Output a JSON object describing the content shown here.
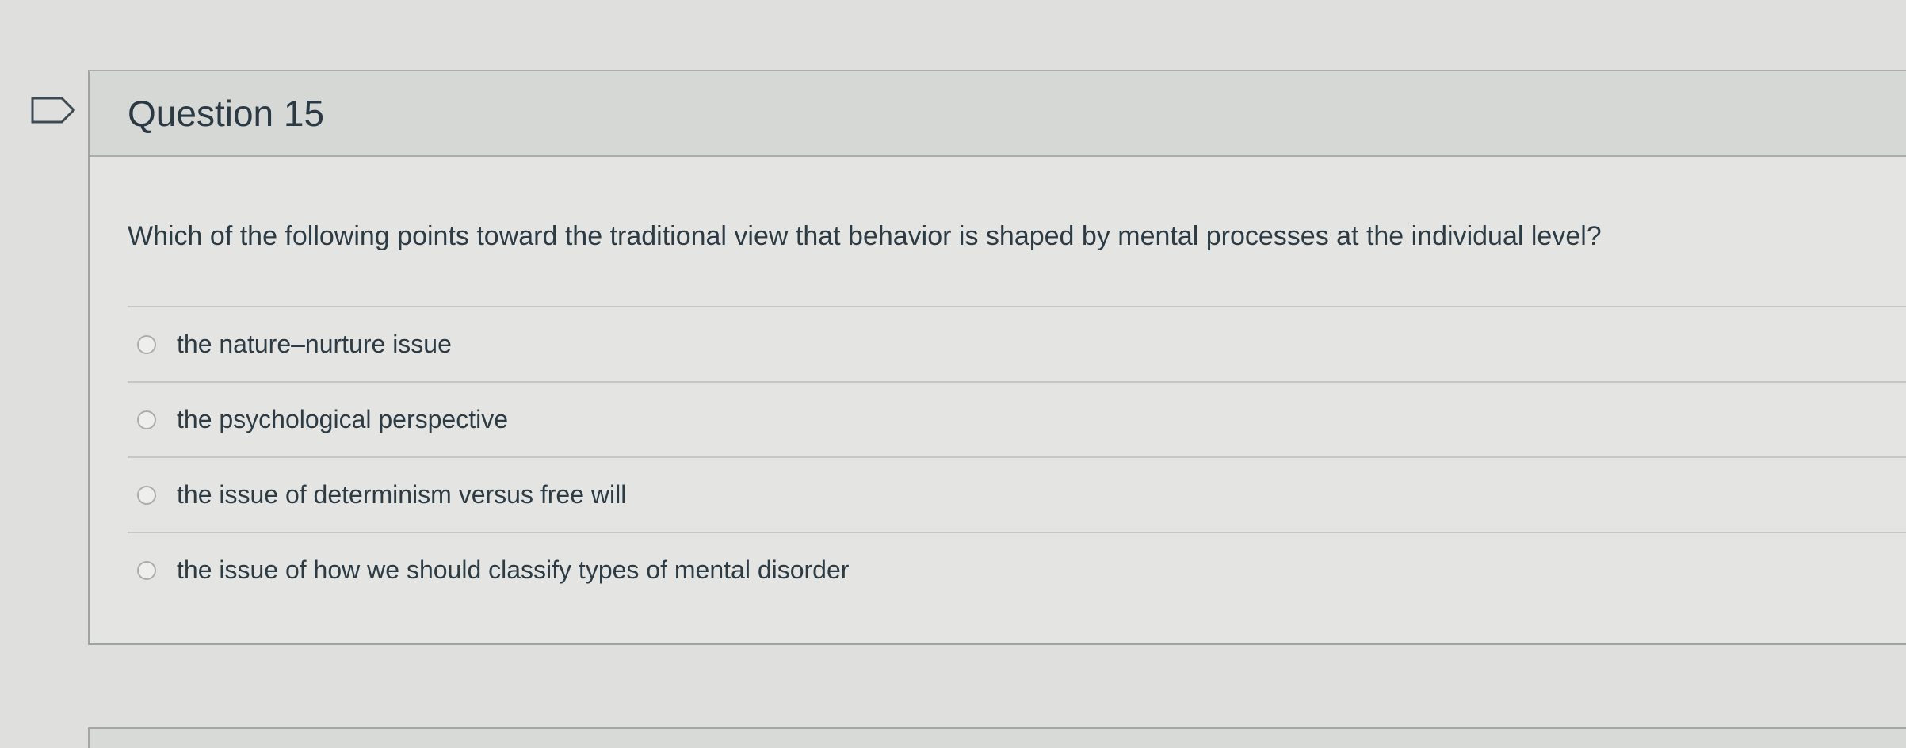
{
  "question": {
    "title": "Question 15",
    "flag_icon": "bookmark-flag-icon",
    "text": "Which of the following points toward the traditional view that behavior is shaped by mental processes at the individual level?",
    "answers": [
      {
        "label": "the nature–nurture issue",
        "selected": false
      },
      {
        "label": "the psychological perspective",
        "selected": false
      },
      {
        "label": "the issue of determinism versus free will",
        "selected": false
      },
      {
        "label": "the issue of how we should classify types of mental disorder",
        "selected": false
      }
    ]
  },
  "colors": {
    "page_background": "#dfe0dd",
    "header_background": "#d6d8d5",
    "text": "#2d3b45",
    "border": "#a8acac"
  }
}
